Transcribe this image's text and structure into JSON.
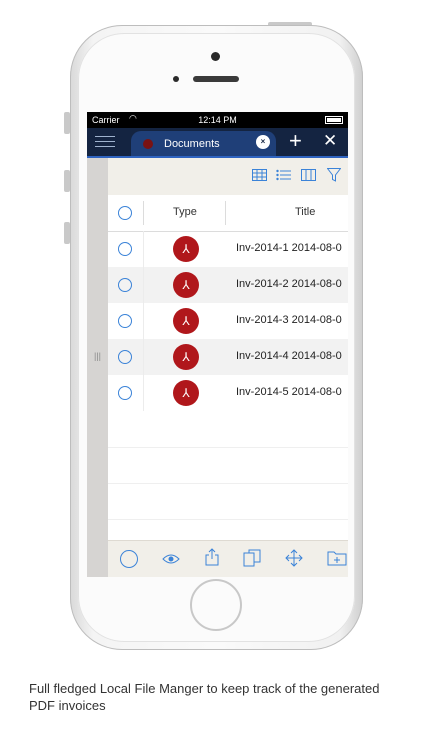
{
  "status_bar": {
    "carrier": "Carrier",
    "time": "12:14 PM"
  },
  "nav": {
    "menu_icon": "hamburger-icon",
    "tab_label": "Documents",
    "tab_close": "×",
    "add": "+",
    "close": "✕"
  },
  "toolbar": {
    "icons": [
      "grid-icon",
      "list-icon",
      "columns-icon",
      "filter-icon"
    ]
  },
  "table": {
    "headers": [
      "Type",
      "Title"
    ],
    "rows": [
      {
        "type_icon": "pdf-icon",
        "title": "Inv-2014-1 2014-08-0"
      },
      {
        "type_icon": "pdf-icon",
        "title": "Inv-2014-2 2014-08-0"
      },
      {
        "type_icon": "pdf-icon",
        "title": "Inv-2014-3 2014-08-0"
      },
      {
        "type_icon": "pdf-icon",
        "title": "Inv-2014-4 2014-08-0"
      },
      {
        "type_icon": "pdf-icon",
        "title": "Inv-2014-5 2014-08-0"
      }
    ]
  },
  "bottom_bar": {
    "icons": [
      "select-circle-icon",
      "eye-icon",
      "share-icon",
      "copy-icon",
      "move-icon",
      "new-folder-icon"
    ]
  },
  "caption": "Full fledged Local File Manger to keep track of the generated PDF invoices",
  "colors": {
    "accent": "#3b83d8",
    "navbar": "#142441",
    "tab": "#1f3f78",
    "pdf": "#b0171b"
  }
}
